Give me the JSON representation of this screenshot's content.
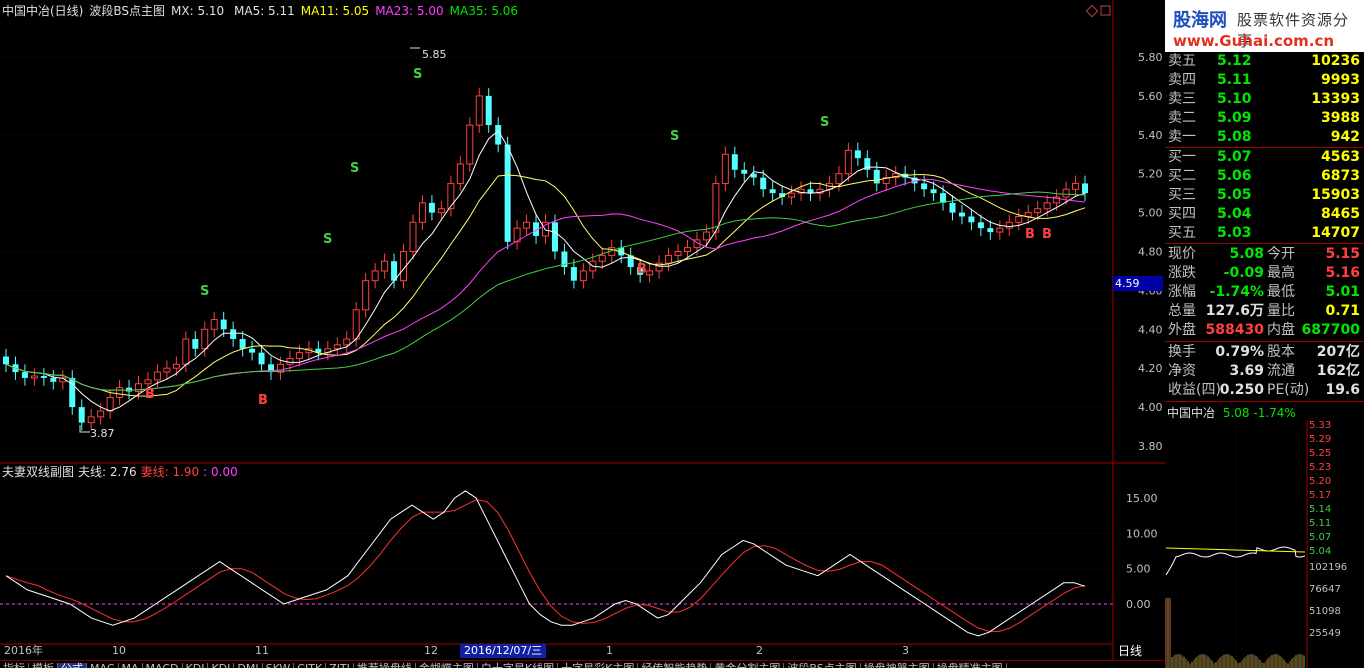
{
  "header": {
    "stock_name": "中国中冶(日线)",
    "indicator": "波段BS点主图",
    "mx": "MX: 5.10",
    "ma5": "MA5: 5.11",
    "ma11": "MA11: 5.05",
    "ma23": "MA23: 5.00",
    "ma35": "MA35: 5.06"
  },
  "sub_header": {
    "title": "夫妻双线副图",
    "husband": "夫线: 2.76",
    "wife": "妻线: 1.90",
    "zero": ": 0.00"
  },
  "price_axis": [
    "5.80",
    "5.60",
    "5.40",
    "5.20",
    "5.00",
    "4.80",
    "4.60",
    "4.40",
    "4.20",
    "4.00",
    "3.80"
  ],
  "current_price_tag": "4.59",
  "sub_axis": [
    "15.00",
    "10.00",
    "5.00",
    "0.00"
  ],
  "annotations": {
    "high": "5.85",
    "low": "3.87"
  },
  "x_axis": {
    "labels": [
      "2016年",
      "10",
      "11",
      "12",
      "1",
      "2",
      "3"
    ],
    "cursor_date": "2016/12/07/三",
    "period_tab": "日线"
  },
  "logo": {
    "main": "股海网",
    "sub": "股票软件资源分享",
    "url": "www.Guhai.com.cn"
  },
  "order_book": {
    "sell": [
      {
        "label": "卖五",
        "price": "5.12",
        "vol": "10236"
      },
      {
        "label": "卖四",
        "price": "5.11",
        "vol": "9993"
      },
      {
        "label": "卖三",
        "price": "5.10",
        "vol": "13393"
      },
      {
        "label": "卖二",
        "price": "5.09",
        "vol": "3988"
      },
      {
        "label": "卖一",
        "price": "5.08",
        "vol": "942"
      }
    ],
    "buy": [
      {
        "label": "买一",
        "price": "5.07",
        "vol": "4563"
      },
      {
        "label": "买二",
        "price": "5.06",
        "vol": "6873"
      },
      {
        "label": "买三",
        "price": "5.05",
        "vol": "15903"
      },
      {
        "label": "买四",
        "price": "5.04",
        "vol": "8465"
      },
      {
        "label": "买五",
        "price": "5.03",
        "vol": "14707"
      }
    ]
  },
  "stats": [
    {
      "l1": "现价",
      "v1": "5.08",
      "c1": "g",
      "l2": "今开",
      "v2": "5.15",
      "c2": "r"
    },
    {
      "l1": "涨跌",
      "v1": "-0.09",
      "c1": "g",
      "l2": "最高",
      "v2": "5.16",
      "c2": "r"
    },
    {
      "l1": "涨幅",
      "v1": "-1.74%",
      "c1": "g",
      "l2": "最低",
      "v2": "5.01",
      "c2": "g"
    },
    {
      "l1": "总量",
      "v1": "127.6万",
      "c1": "w",
      "l2": "量比",
      "v2": "0.71",
      "c2": "y"
    },
    {
      "l1": "外盘",
      "v1": "588430",
      "c1": "r",
      "l2": "内盘",
      "v2": "687700",
      "c2": "g"
    },
    {
      "l1": "换手",
      "v1": "0.79%",
      "c1": "w",
      "l2": "股本",
      "v2": "207亿",
      "c2": "w"
    },
    {
      "l1": "净资",
      "v1": "3.69",
      "c1": "w",
      "l2": "流通",
      "v2": "162亿",
      "c2": "w"
    },
    {
      "l1": "收益(四)",
      "v1": "0.250",
      "c1": "w",
      "l2": "PE(动)",
      "v2": "19.6",
      "c2": "w"
    }
  ],
  "mini_chart": {
    "title": "中国中冶",
    "quote": "5.08 -1.74%",
    "axis": [
      "5.33",
      "5.29",
      "5.25",
      "5.23",
      "5.20",
      "5.17",
      "5.14",
      "5.11",
      "5.07",
      "5.04"
    ],
    "vol_axis": [
      "102196",
      "76647",
      "51098",
      "25549"
    ]
  },
  "bottom_tabs": [
    "指标",
    "模板",
    "公式",
    "MAC",
    "MA",
    "MACD",
    "KDJ",
    "KDJ",
    "DMI",
    "SKW",
    "CJTK",
    "ZJTJ",
    "推荐操盘线",
    "金蝴蝶主图",
    "白十字星K线图",
    "十字星彩K主图",
    "经传智能趋势",
    "黄金分割主图",
    "波段BS点主图",
    "操盘神器主图",
    "操盘精准主图"
  ]
}
